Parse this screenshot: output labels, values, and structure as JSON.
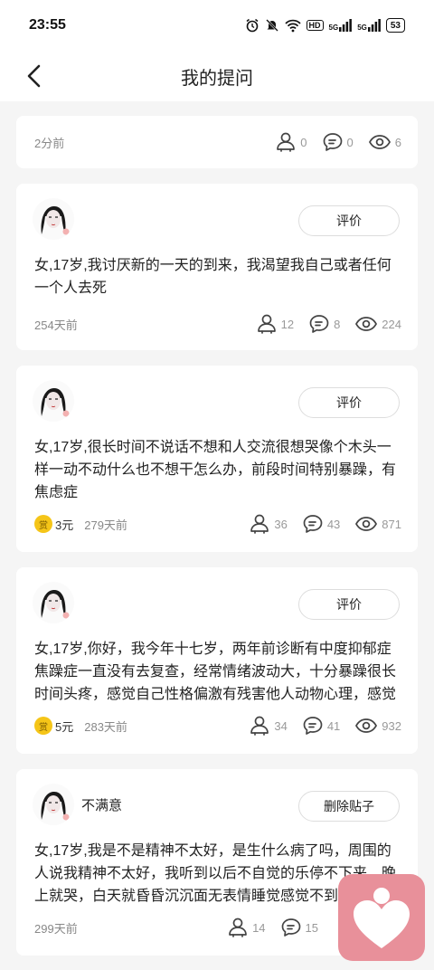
{
  "status_bar": {
    "time": "23:55",
    "network_hd": "HD",
    "signal_1": "5G",
    "signal_2": "5G",
    "battery": "53"
  },
  "header": {
    "title": "我的提问"
  },
  "cards": [
    {
      "time": "2分前",
      "answers": "0",
      "comments": "0",
      "views": "6"
    },
    {
      "action": "评价",
      "text": "女,17岁,我讨厌新的一天的到来，我渴望我自己或者任何一个人去死",
      "time": "254天前",
      "answers": "12",
      "comments": "8",
      "views": "224"
    },
    {
      "action": "评价",
      "text": "女,17岁,很长时间不说话不想和人交流很想哭像个木头一样一动不动什么也不想干怎么办，前段时间特别暴躁，有焦虑症",
      "reward_icon": "赏",
      "reward": "3元",
      "time": "279天前",
      "answers": "36",
      "comments": "43",
      "views": "871"
    },
    {
      "action": "评价",
      "text": "女,17岁,你好，我今年十七岁，两年前诊断有中度抑郁症焦躁症一直没有去复查，经常情绪波动大，十分暴躁很长时间头疼，感觉自己性格偏激有残害他人动物心理，感觉",
      "reward_icon": "赏",
      "reward": "5元",
      "time": "283天前",
      "answers": "34",
      "comments": "41",
      "views": "932"
    },
    {
      "label": "不满意",
      "action": "删除贴子",
      "text": "女,17岁,我是不是精神不太好，是生什么病了吗，周围的人说我精神不太好，我听到以后不自觉的乐停不下来，晚上就哭，白天就昏昏沉沉面无表情睡觉感觉不到快乐",
      "time": "299天前",
      "answers": "14",
      "comments": "15"
    }
  ],
  "icons": {
    "answers": "person-icon",
    "comments": "comment-icon",
    "views": "eye-icon",
    "back": "chevron-left-icon"
  },
  "colors": {
    "reward": "#f5c518",
    "logo": "#e8909a"
  }
}
